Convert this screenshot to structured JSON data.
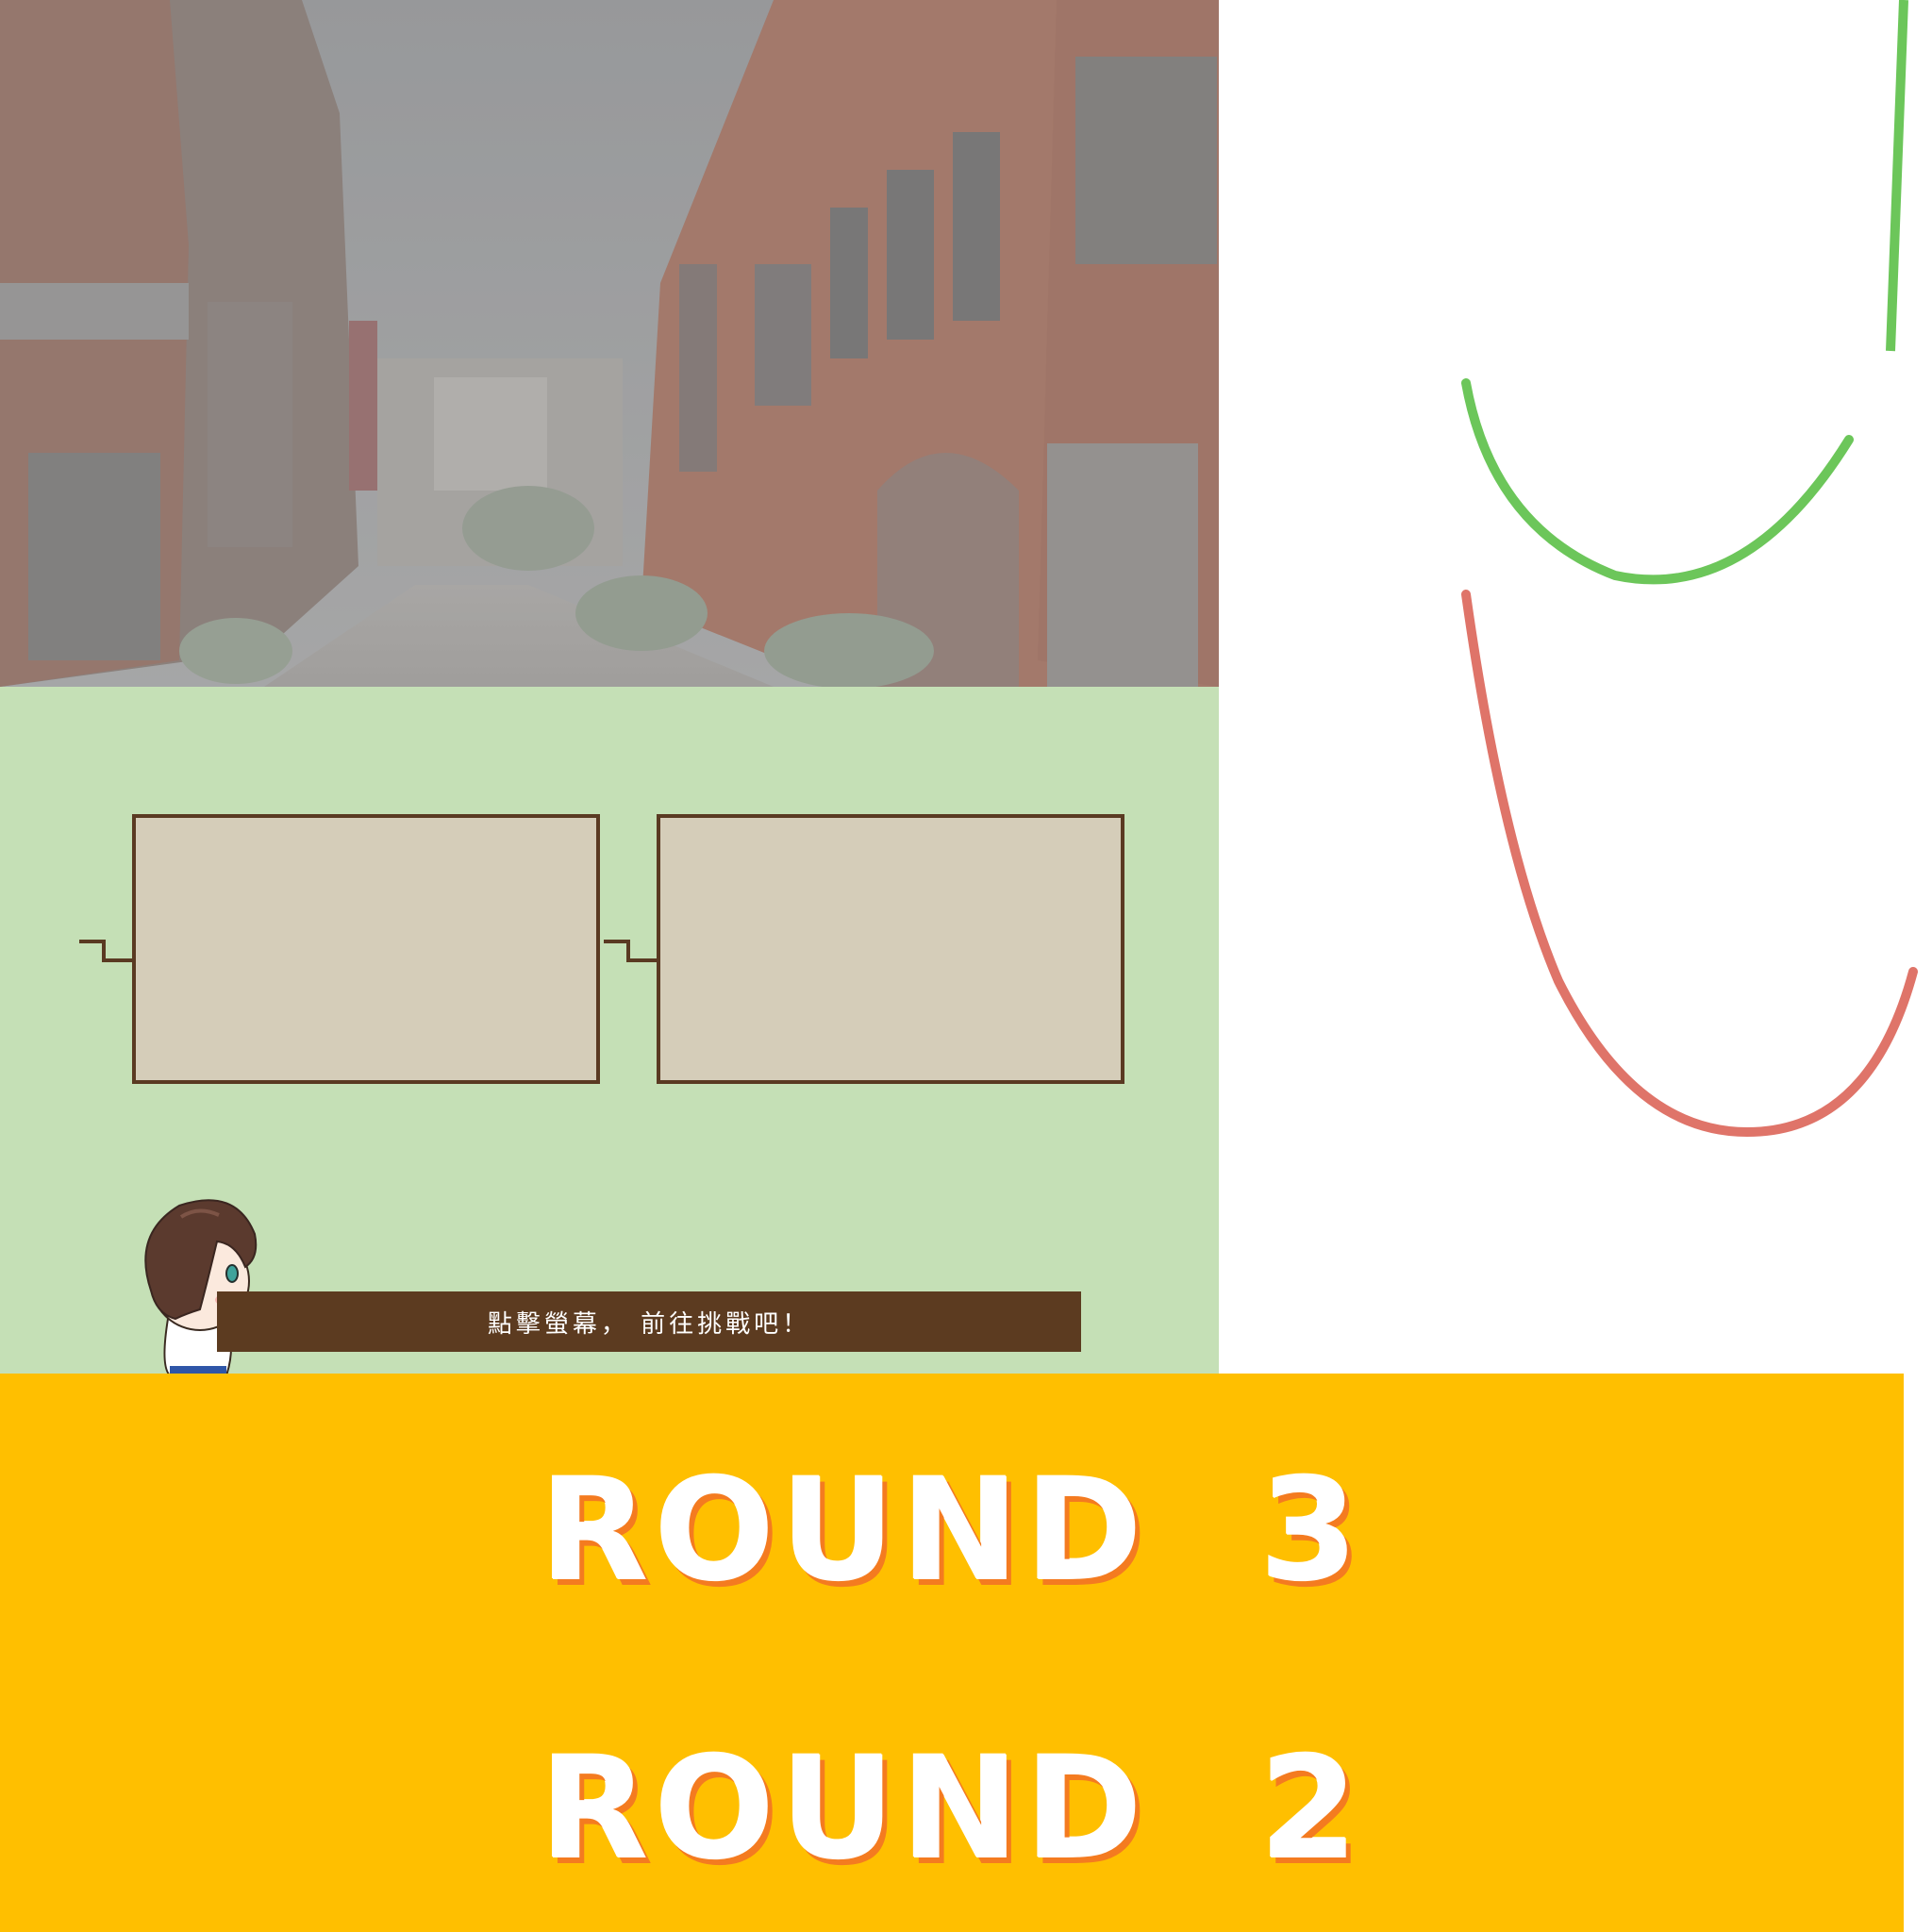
{
  "scene": {
    "background_name": "old-street-brick-buildings",
    "panel_color": "#c5e0b6",
    "box_fill": "#d5cdb9",
    "box_border": "#5a3a22"
  },
  "dialog": {
    "text": "點擊螢幕， 前往挑戰吧！"
  },
  "arcs": {
    "green_color": "#6cc65a",
    "red_color": "#df7469"
  },
  "rounds": {
    "background": "#ffbf00",
    "items": [
      {
        "label": "ROUND 3"
      },
      {
        "label": "ROUND 2"
      }
    ]
  }
}
